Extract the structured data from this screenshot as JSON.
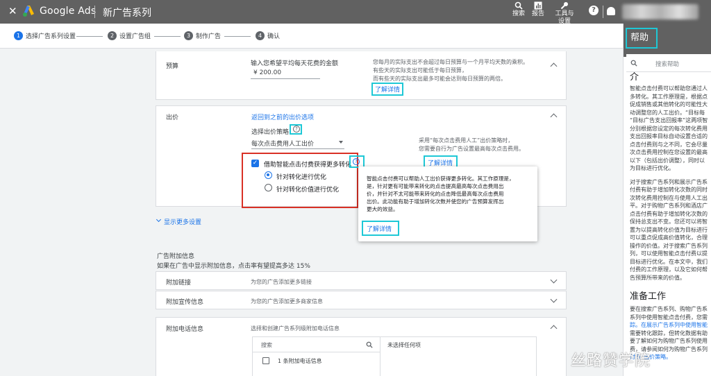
{
  "topbar": {
    "close": "✕",
    "brand": "Google Ads",
    "campaign_title": "新广告系列",
    "search_label": "搜索",
    "reports_label": "报告",
    "tools_label": "工具与\n设置"
  },
  "steps": [
    {
      "num": "1",
      "label": "选择广告系列设置"
    },
    {
      "num": "2",
      "label": "设置广告组"
    },
    {
      "num": "3",
      "label": "制作广告"
    },
    {
      "num": "4",
      "label": "确认"
    }
  ],
  "budget": {
    "label": "预算",
    "prompt": "输入您希望平均每天花费的金额",
    "value": "¥ 200.00",
    "desc1": "您每月的实际支出不会超过每日预算与一个月平均天数的乘积。",
    "desc2": "有些天的实际支出可能低于每日预算，",
    "desc3": "而有些天的实际支出最多可能会达到每日预算的两倍。",
    "learn_more": "了解详情"
  },
  "bidding": {
    "label": "出价",
    "back_link": "返回到之前的出价选项",
    "strategy_label": "选择出价策略",
    "strategy_value": "每次点击费用人工出价",
    "side1": "采用“每次点击费用人工”出价策略时，",
    "side2": "您需要自行为广告设置最高每次点击费用。",
    "learn_more": "了解详情",
    "enhanced_label": "借助智能点击付费获得更多转化",
    "opt1": "针对转化进行优化",
    "opt2": "针对转化价值进行优化"
  },
  "tooltip": {
    "lines": [
      "智能点击付费可以帮助人工出价获得更多转化。其工作原理是，",
      "是，针对更有可能带来转化的点击提高最高每次点击费用出",
      "价，并针对不太可能带来转化的点击降低最高每次点击费用",
      "出价。此功能有助于增加转化次数并使您的广告预算发挥出",
      "更大的效益。"
    ],
    "learn_more": "了解详情"
  },
  "more_settings": "显示更多设置",
  "extensions": {
    "title": "广告附加信息",
    "subtitle": "如果在广告中显示附加信息，点击率有望提高多达 15%",
    "rows": [
      {
        "label": "附加链接",
        "hint": "为您的广告添加更多链接"
      },
      {
        "label": "附加宣传信息",
        "hint": "为您的广告添加更多商家信息"
      }
    ],
    "call": {
      "label": "附加电话信息",
      "hint": "选择和创建广告系列级附加电话信息",
      "search_placeholder": "搜索",
      "none_selected": "未选择任何项",
      "item": "1 条附加电话信息"
    }
  },
  "help": {
    "title": "帮助",
    "search_placeholder": "搜索帮助",
    "intro_head": "介",
    "para1": [
      "智能点击付费可以帮助您通过人",
      "多转化。其工作原理是，根据点",
      "促成销售或其他转化的可能性大",
      "动调整您的人工出价。“目标每",
      "“目标广告支出回报率”这两项智",
      "分别根据您设定的每次转化费用",
      "支出回报率目标自动设置合适的",
      "点击付费则与之不同，它会尽量",
      "次点击费用控制在您设置的最高",
      "以下（包括出价调整），同时以",
      "为目标进行优化。"
    ],
    "para2": [
      "对于搜索广告系列和展示广告系",
      "付费有助于增加转化次数的同时",
      "次转化费用控制在与使用人工出",
      "平。对于购物广告系列和酒店广",
      "点击付费有助于增加转化次数的",
      "保持总支出不变。您还可以将智",
      "置为以提高转化价值为目标进行",
      "可以重点促成高价值转化，合理",
      "操作的价值。对于搜索广告系列",
      "列，可以使用智能点击付费以提",
      "目标进行优化。在本文中，我们",
      "付费的工作原理，以及它如何帮",
      "告预算所带来的价值。"
    ],
    "prep_head": "准备工作",
    "para3": [
      "要在搜索广告系列、购物广告系",
      "系列中使用智能点击付费，您需",
      "踪。在展示广告系列中使用智能",
      "需要转化跟踪，但转化数据有助",
      "要了解如何为购物广告系列使用",
      "费，请参阅如何为购物广告系列",
      "付费”出价策略。"
    ]
  },
  "watermark": "丝路赞学院"
}
